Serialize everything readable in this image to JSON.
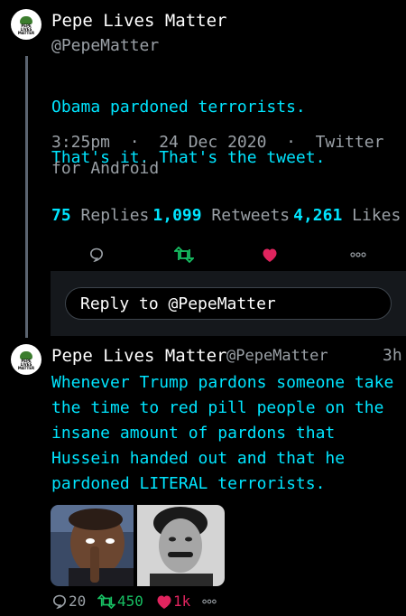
{
  "tweet1": {
    "author_name": "Pepe Lives Matter",
    "author_handle": "@PepeMatter",
    "avatar_text": "PEPE LIVES MATTER",
    "text_line1": "Obama pardoned terrorists.",
    "text_line2": "That's it. That's the tweet.",
    "meta_line1": "3:25pm  ·  24 Dec 2020  ·  Twitter",
    "meta_line2": "for Android",
    "replies_count": "75",
    "replies_label": "Replies",
    "retweets_count": "1,099",
    "retweets_label": "Retweets",
    "likes_count": "4,261",
    "likes_label": "Likes"
  },
  "reply_box": {
    "placeholder": "Reply to @PepeMatter"
  },
  "tweet2": {
    "author_name": "Pepe Lives Matter",
    "author_handle": "@PepeMatter",
    "time": "3h",
    "text": "Whenever Trump pardons someone take\nthe time to red pill people on the\ninsane amount of pardons that\nHussein handed out and that he\npardoned LITERAL terrorists.",
    "replies": "20",
    "retweets": "450",
    "likes": "1k"
  },
  "icons": {
    "reply": "speech-bubble-icon",
    "retweet": "retweet-icon",
    "like": "heart-icon",
    "more": "more-dots-icon"
  },
  "colors": {
    "background": "#000000",
    "tweet_text": "#00e5ff",
    "muted": "#9aa0a6",
    "retweet_green": "#17bf63",
    "like_red": "#e0245e",
    "reply_panel": "#15181c"
  }
}
